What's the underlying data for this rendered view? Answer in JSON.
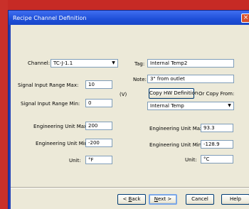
{
  "window": {
    "title": "Recipe Channel Definition",
    "close_glyph": "×"
  },
  "form": {
    "channel": {
      "label": "Channel:",
      "value": "TC-J-1.1"
    },
    "tag": {
      "label": "Tag:",
      "value": "Internal Temp2"
    },
    "note": {
      "label": "Note:",
      "value": "3\" from outlet"
    },
    "signal_max": {
      "label": "Signal Input Range Max:",
      "value": "10"
    },
    "signal_min": {
      "label": "Signal Input Range Min:",
      "value": "0"
    },
    "signal_unit": "(V)",
    "copy_hw_button": "Copy HW Definition",
    "or_copy_from_label": "Or Copy From:",
    "copy_from_value": "Internal Temp",
    "left_eng_max": {
      "label": "Engineering Unit Max:",
      "value": "200"
    },
    "left_eng_min": {
      "label": "Engineering Unit Min:",
      "value": "-200"
    },
    "left_unit": {
      "label": "Unit:",
      "value": "°F"
    },
    "right_eng_max": {
      "label": "Engineering Unit Max:",
      "value": "93.3"
    },
    "right_eng_min": {
      "label": "Engineering Unit Min:",
      "value": "-128.9"
    },
    "right_unit": {
      "label": "Unit:",
      "value": "°C"
    }
  },
  "buttons": {
    "back_prefix": "< ",
    "back_key": "B",
    "back_rest": "ack",
    "next_key": "N",
    "next_rest": "ext >",
    "cancel": "Cancel",
    "help": "Help"
  },
  "icons": {
    "dropdown": "chevron-down-icon",
    "close": "close-icon"
  },
  "colors": {
    "titlebar": "#1e4fd8",
    "desktop": "#c62a25",
    "client": "#ece9d8"
  }
}
